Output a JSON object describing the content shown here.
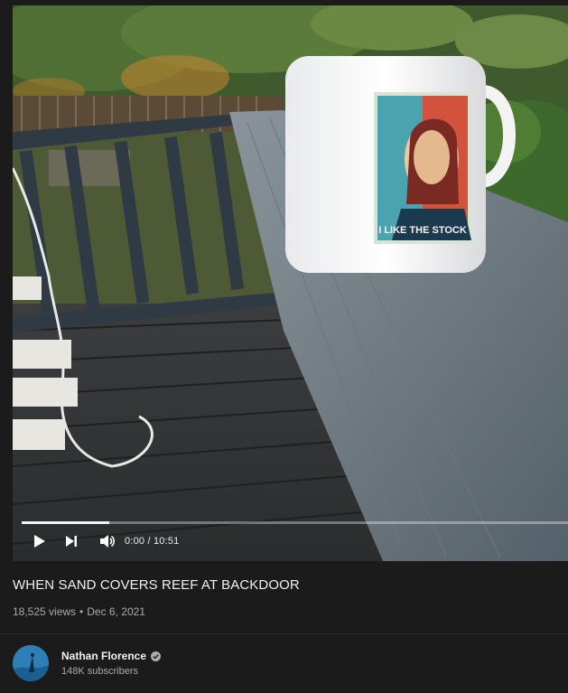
{
  "video": {
    "mug_caption": "I LIKE THE STOCK",
    "progress_fraction": 0.16,
    "controls": {
      "time_display": "0:00 / 10:51",
      "play_icon": "play-icon",
      "next_icon": "skip-next-icon",
      "volume_icon": "volume-icon"
    }
  },
  "details": {
    "title": "WHEN SAND COVERS REEF AT BACKDOOR",
    "views": "18,525 views",
    "separator": "•",
    "date": "Dec 6, 2021"
  },
  "channel": {
    "name": "Nathan Florence",
    "subscribers": "148K subscribers",
    "verified_icon": "verified-check-icon"
  },
  "colors": {
    "background": "#1b1b1b",
    "text_primary": "#f1f1f1",
    "text_secondary": "#aaaaaa",
    "progress": "#f2f2f2"
  }
}
